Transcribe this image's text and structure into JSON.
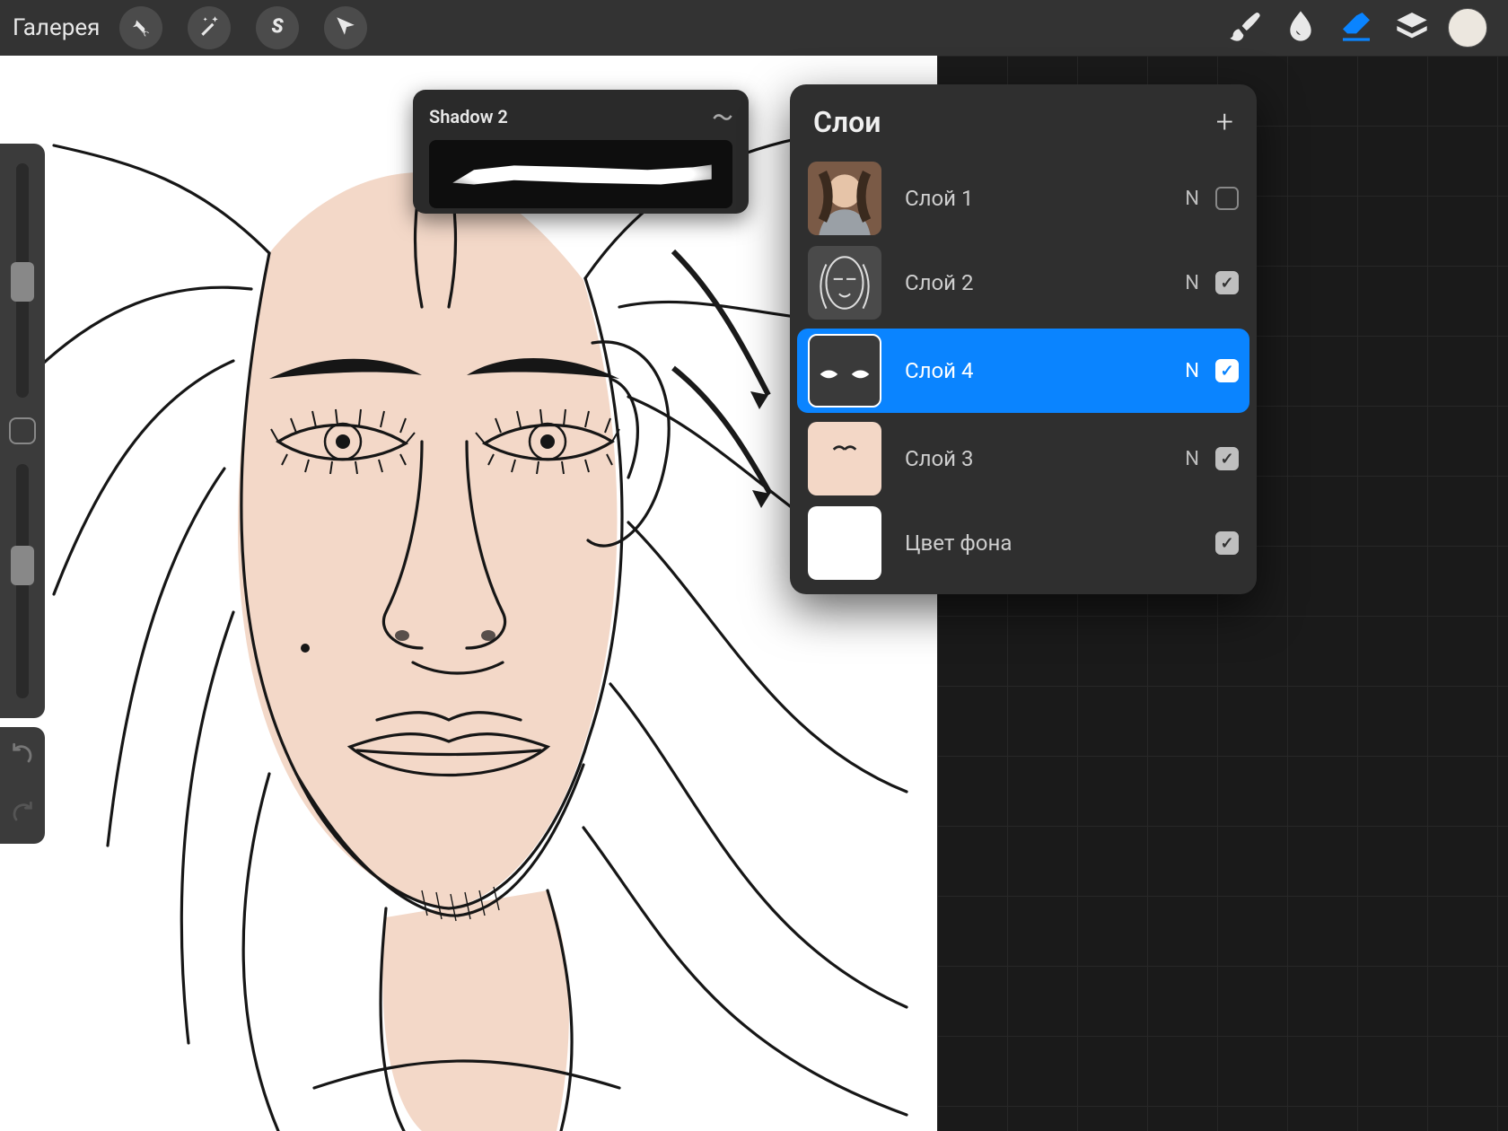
{
  "topbar": {
    "gallery_label": "Галерея",
    "icons": {
      "wrench": "wrench-icon",
      "wand": "wand-icon",
      "s_tool": "select-icon",
      "arrow": "move-icon",
      "brush": "brush-icon",
      "smudge": "smudge-icon",
      "eraser": "eraser-icon",
      "layers": "layers-icon",
      "color": "color-swatch"
    },
    "active_tool": "eraser",
    "color_swatch_hex": "#ece7df"
  },
  "sidebar": {
    "brush_size_slider_pos": 0.42,
    "opacity_slider_pos": 0.35,
    "undo_label": "undo",
    "redo_label": "redo"
  },
  "brush_popup": {
    "name": "Shadow 2"
  },
  "layers_panel": {
    "title": "Слои",
    "add_label": "+",
    "blend_short": "N",
    "items": [
      {
        "name": "Слой 1",
        "blend": "N",
        "visible": false,
        "selected": false,
        "thumb": "photo"
      },
      {
        "name": "Слой 2",
        "blend": "N",
        "visible": true,
        "selected": false,
        "thumb": "sketch"
      },
      {
        "name": "Слой 4",
        "blend": "N",
        "visible": true,
        "selected": true,
        "thumb": "eyes"
      },
      {
        "name": "Слой 3",
        "blend": "N",
        "visible": true,
        "selected": false,
        "thumb": "skin"
      },
      {
        "name": "Цвет фона",
        "blend": "",
        "visible": true,
        "selected": false,
        "thumb": "white",
        "is_bg": true
      }
    ]
  },
  "colors": {
    "accent": "#0a84ff",
    "panel": "#2f2f2f",
    "toolbar": "#333333"
  }
}
